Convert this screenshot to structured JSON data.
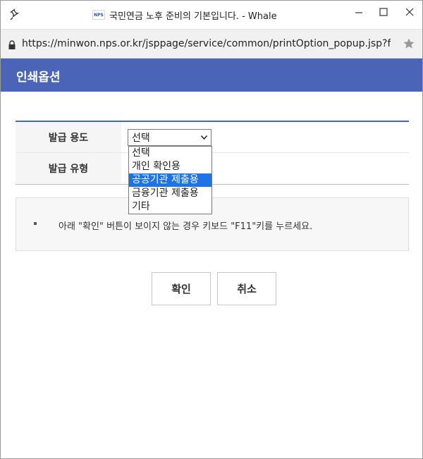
{
  "window": {
    "title": "국민연금 노후 준비의 기본입니다. - Whale",
    "favicon_text": "NPS"
  },
  "addressbar": {
    "url": "https://minwon.nps.or.kr/jsppage/service/common/printOption_popup.jsp?frmInfo"
  },
  "header": {
    "title": "인쇄옵션"
  },
  "form": {
    "rows": [
      {
        "label": "발급 용도",
        "select_value": "선택"
      },
      {
        "label": "발급 유형"
      }
    ],
    "dropdown": {
      "options": [
        "선택",
        "개인 확인용",
        "공공기관 제출용",
        "금융기관 제출용",
        "기타"
      ],
      "highlighted": "공공기관 제출용"
    }
  },
  "notice": {
    "text": "아래 \"확인\" 버튼이 보이지 않는 경우 키보드 \"F11\"키를 누르세요."
  },
  "buttons": {
    "confirm": "확인",
    "cancel": "취소"
  },
  "colors": {
    "accent": "#4a64b8",
    "selection": "#1e73e8"
  }
}
